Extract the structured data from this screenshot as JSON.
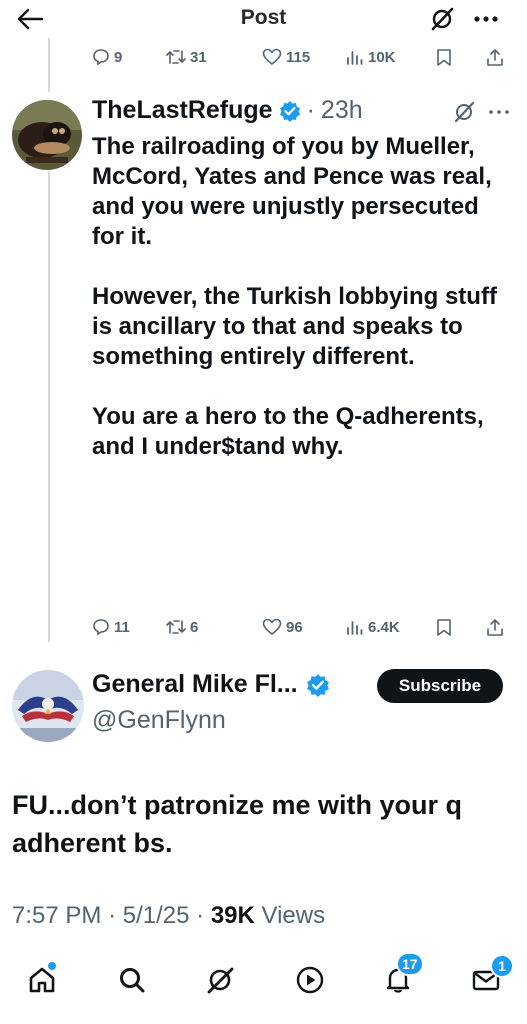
{
  "header": {
    "title": "Post"
  },
  "prev_tweet_actions": {
    "replies": "9",
    "reposts": "31",
    "likes": "115",
    "views": "10K"
  },
  "reply_tweet": {
    "author_name": "TheLastRefuge",
    "separator": "·",
    "time": "23h",
    "paragraphs": [
      "The railroading of you by Mueller, McCord, Yates and Pence was real, and you were unjustly persecuted for it.",
      "However, the Turkish lobbying stuff is ancillary to that and speaks to something entirely different.",
      "You are a hero to the Q-adherents, and I under$tand why."
    ],
    "actions": {
      "replies": "11",
      "reposts": "6",
      "likes": "96",
      "views": "6.4K"
    }
  },
  "main_tweet": {
    "author_name": "General Mike Fl...",
    "handle": "@GenFlynn",
    "subscribe_label": "Subscribe",
    "text": "FU...don’t patronize me with your q adherent bs.",
    "time": "7:57 PM",
    "date": "5/1/25",
    "views_count": "39K",
    "views_label": "Views",
    "meta_sep": "·"
  },
  "bottom_nav": {
    "notifications_badge": "17",
    "messages_badge": "1"
  },
  "colors": {
    "accent": "#1d9bf0",
    "text": "#0f1419",
    "secondary": "#536471"
  }
}
